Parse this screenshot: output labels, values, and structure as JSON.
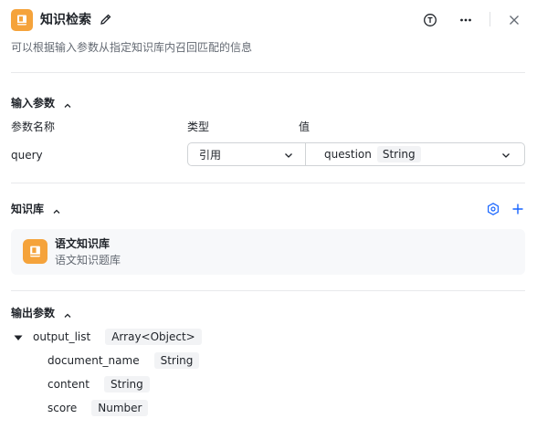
{
  "header": {
    "title": "知识检索",
    "description": "可以根据输入参数从指定知识库内召回匹配的信息",
    "icons": [
      "book-icon",
      "edit-icon",
      "type-t-icon",
      "more-icon",
      "close-icon"
    ]
  },
  "input_section": {
    "title": "输入参数",
    "columns": {
      "name": "参数名称",
      "type": "类型",
      "value": "值"
    },
    "rows": [
      {
        "name": "query",
        "type": "引用",
        "value": "question",
        "value_type": "String"
      }
    ]
  },
  "knowledge_section": {
    "title": "知识库",
    "items": [
      {
        "name": "语文知识库",
        "description": "语文知识题库"
      }
    ]
  },
  "output_section": {
    "title": "输出参数",
    "root": {
      "name": "output_list",
      "type": "Array<Object>"
    },
    "children": [
      {
        "name": "document_name",
        "type": "String"
      },
      {
        "name": "content",
        "type": "String"
      },
      {
        "name": "score",
        "type": "Number"
      }
    ]
  },
  "colors": {
    "accent": "#1664ff",
    "book_icon": "#f5a33b",
    "tag_bg": "#f2f3f5"
  }
}
